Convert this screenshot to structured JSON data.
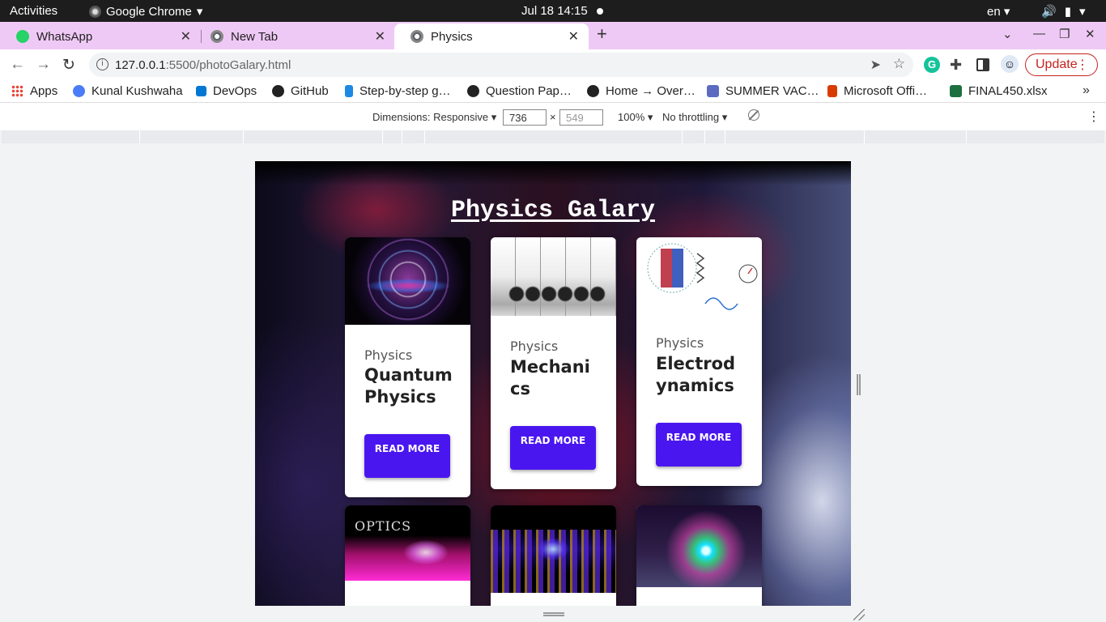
{
  "system_bar": {
    "activities": "Activities",
    "app_name": "Google Chrome",
    "clock": "Jul 18  14:15",
    "language": "en"
  },
  "tabs": [
    {
      "title": "WhatsApp",
      "favicon_color": "#25d366",
      "active": false
    },
    {
      "title": "New Tab",
      "favicon_color": "#5f6368",
      "active": false
    },
    {
      "title": "Physics",
      "favicon_color": "#5f6368",
      "active": true
    }
  ],
  "toolbar": {
    "url_host": "127.0.0.1",
    "url_path": ":5500/photoGalary.html",
    "update_label": "Update"
  },
  "bookmarks": [
    {
      "label": "Apps",
      "icon": "apps-grid-icon",
      "color": "#ea4335"
    },
    {
      "label": "Kunal Kushwaha",
      "icon": "kk-icon",
      "color": "#4a7cf7"
    },
    {
      "label": "DevOps",
      "icon": "devops-icon",
      "color": "#0078d4"
    },
    {
      "label": "GitHub",
      "icon": "github-icon",
      "color": "#222222"
    },
    {
      "label": "Step-by-step g…",
      "icon": "docs-icon",
      "color": "#1e88e5"
    },
    {
      "label": "Question Pap…",
      "icon": "globe-icon",
      "color": "#222222"
    },
    {
      "label": "Home → Over…",
      "icon": "globe-icon",
      "color": "#222222"
    },
    {
      "label": "SUMMER VAC…",
      "icon": "forms-icon",
      "color": "#5c6bc0"
    },
    {
      "label": "Microsoft Offi…",
      "icon": "office-icon",
      "color": "#d83b01"
    },
    {
      "label": "FINAL450.xlsx",
      "icon": "excel-icon",
      "color": "#1d6f42"
    }
  ],
  "devtools": {
    "dimensions_label": "Dimensions: Responsive",
    "width": "736",
    "height": "549",
    "zoom": "100%",
    "throttling": "No throttling"
  },
  "page": {
    "title": "Physics Galary",
    "cards": [
      {
        "category": "Physics",
        "name": "Quantum Physics",
        "button": "READ MORE"
      },
      {
        "category": "Physics",
        "name": "Mechanics",
        "button": "READ MORE"
      },
      {
        "category": "Physics",
        "name": "Electrodynamics",
        "button": "READ MORE"
      }
    ],
    "optics_image_text": "OPTICS",
    "accent_color": "#4a16f0"
  }
}
